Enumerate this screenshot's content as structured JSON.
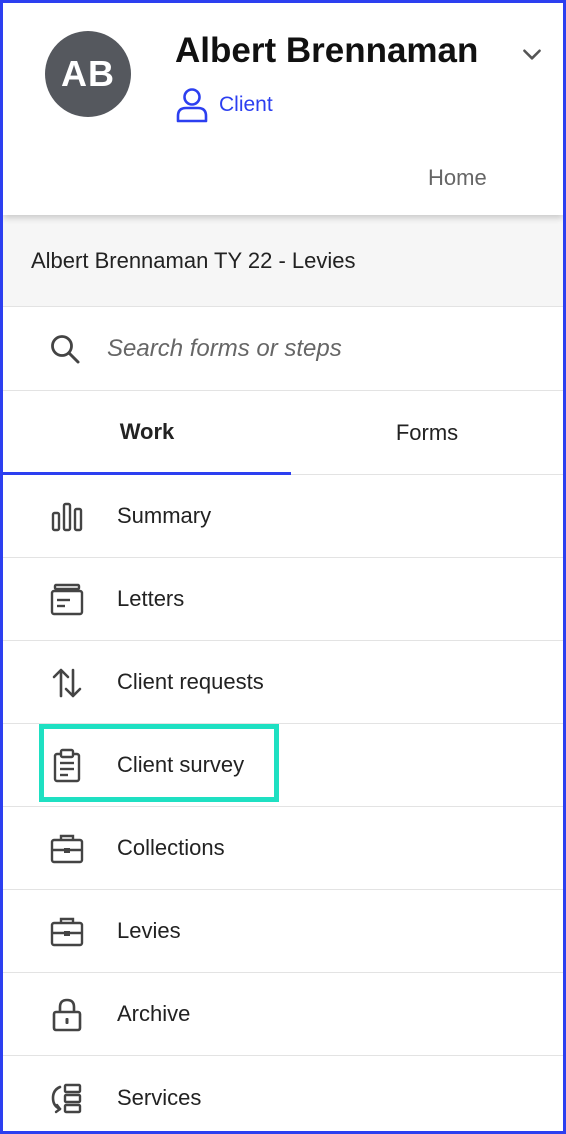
{
  "header": {
    "avatar_initials": "AB",
    "client_name": "Albert Brennaman",
    "role_label": "Client",
    "home_label": "Home"
  },
  "engagement": {
    "title": "Albert Brennaman TY 22 - Levies"
  },
  "search": {
    "placeholder": "Search forms or steps",
    "value": ""
  },
  "tabs": [
    {
      "label": "Work",
      "active": true
    },
    {
      "label": "Forms",
      "active": false
    }
  ],
  "nav": {
    "items": [
      {
        "label": "Summary",
        "icon": "bar-chart-icon"
      },
      {
        "label": "Letters",
        "icon": "letter-tray-icon"
      },
      {
        "label": "Client requests",
        "icon": "up-down-arrows-icon"
      },
      {
        "label": "Client survey",
        "icon": "clipboard-icon",
        "highlighted": true
      },
      {
        "label": "Collections",
        "icon": "briefcase-icon"
      },
      {
        "label": "Levies",
        "icon": "briefcase-icon"
      },
      {
        "label": "Archive",
        "icon": "lock-icon"
      },
      {
        "label": "Services",
        "icon": "services-icon"
      }
    ]
  },
  "colors": {
    "accent": "#2c3ff0",
    "highlight": "#1ee0c2",
    "avatar": "#55585e"
  }
}
